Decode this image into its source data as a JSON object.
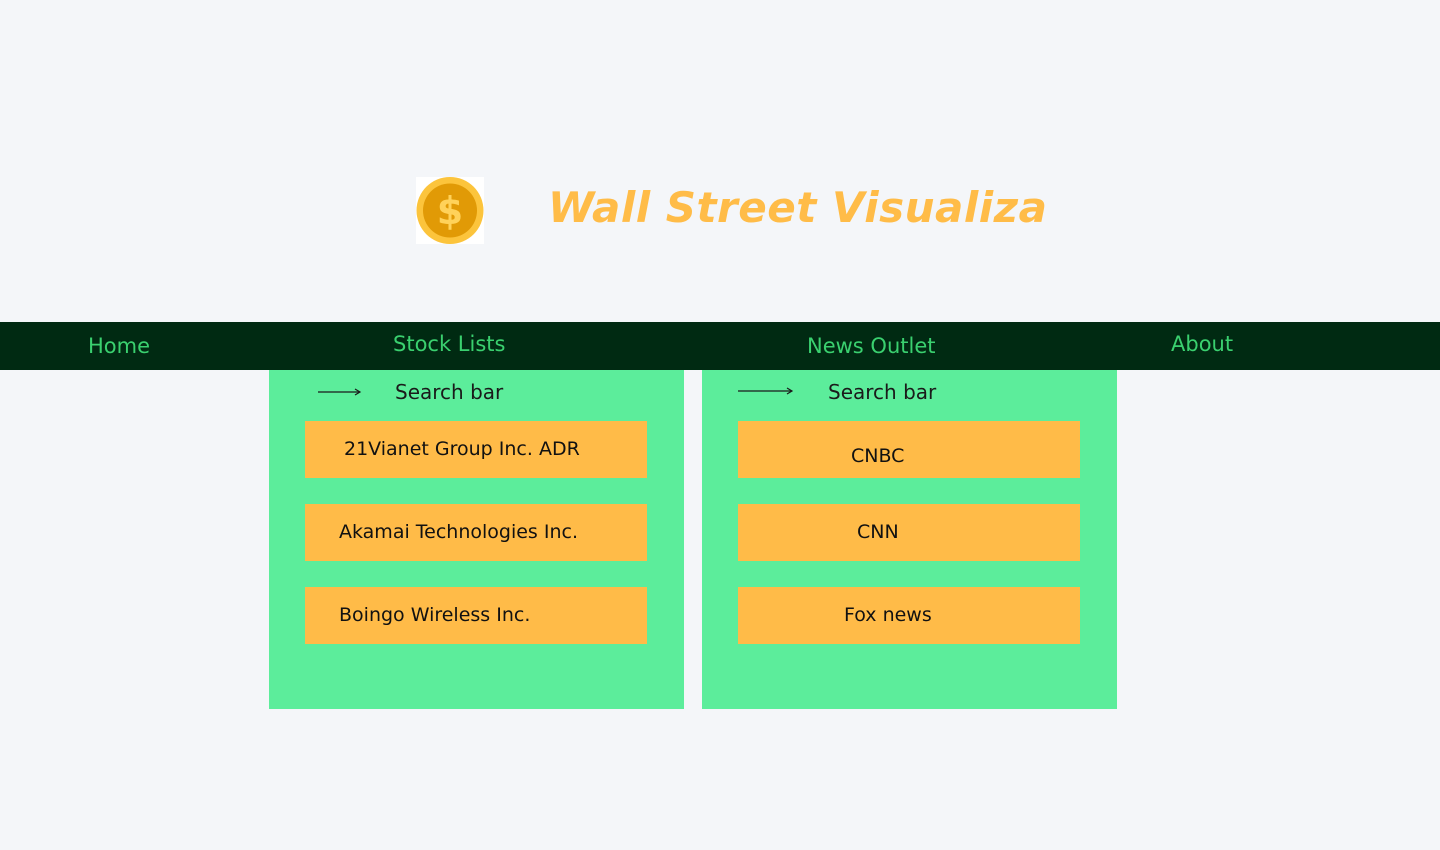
{
  "header": {
    "title": "Wall Street Visualiza",
    "logo_icon": "dollar-coin-icon"
  },
  "nav": {
    "home": "Home",
    "stock_lists": "Stock Lists",
    "news_outlet": "News Outlet",
    "about": "About"
  },
  "stocks_panel": {
    "search_label": "Search bar",
    "items": [
      "21Vianet Group Inc. ADR",
      "Akamai Technologies Inc.",
      "Boingo Wireless Inc."
    ]
  },
  "news_panel": {
    "search_label": "Search bar",
    "items": [
      "CNBC",
      "CNN",
      "Fox news"
    ]
  },
  "colors": {
    "background": "#f4f6f9",
    "title": "#ffbc48",
    "navbar": "#002a12",
    "nav_text": "#3ad06f",
    "panel": "#5ced9b",
    "item": "#ffbb48"
  }
}
